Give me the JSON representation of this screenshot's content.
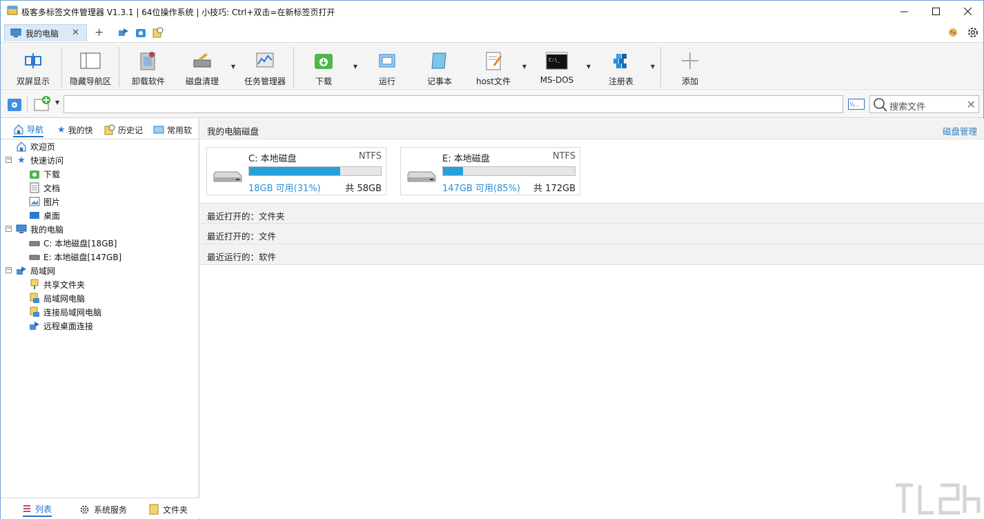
{
  "titlebar": {
    "title": "极客多标签文件管理器 V1.3.1  |  64位操作系统 | 小技巧: Ctrl+双击=在新标签页打开"
  },
  "tabs": {
    "active_label": "我的电脑",
    "new_tab": "+"
  },
  "toolbar": {
    "dual_screen": "双屏显示",
    "hide_nav": "隐藏导航区",
    "uninstall": "卸载软件",
    "disk_clean": "磁盘清理",
    "task_manager": "任务管理器",
    "download": "下载",
    "run": "运行",
    "notepad": "记事本",
    "hosts": "host文件",
    "msdos": "MS-DOS",
    "registry": "注册表",
    "add": "添加"
  },
  "search": {
    "placeholder": "搜索文件"
  },
  "left_tabs": {
    "nav": "导航",
    "favorites": "我的快",
    "history": "历史记",
    "common": "常用软"
  },
  "tree": {
    "welcome": "欢迎页",
    "quick_access": "快速访问",
    "downloads": "下载",
    "documents": "文档",
    "pictures": "图片",
    "desktop": "桌面",
    "my_computer": "我的电脑",
    "disk_c": "C: 本地磁盘[18GB]",
    "disk_e": "E: 本地磁盘[147GB]",
    "lan": "局域网",
    "shared": "共享文件夹",
    "lan_pc": "局域网电脑",
    "connect_lan": "连接局域网电脑",
    "remote_desktop": "远程桌面连接"
  },
  "left_bottom": {
    "list": "列表",
    "services": "系统服务",
    "folder": "文件夹"
  },
  "main": {
    "disks_title": "我的电脑磁盘",
    "disk_manage": "磁盘管理",
    "disks": [
      {
        "name": "C: 本地磁盘",
        "fs": "NTFS",
        "free": "18GB 可用(31%)",
        "total": "共 58GB",
        "used_fraction": 0.69
      },
      {
        "name": "E: 本地磁盘",
        "fs": "NTFS",
        "free": "147GB 可用(85%)",
        "total": "共 172GB",
        "used_fraction": 0.15
      }
    ],
    "recent_folders": "最近打开的：文件夹",
    "recent_files": "最近打开的：文件",
    "recent_software": "最近运行的：软件"
  },
  "colors": {
    "accent": "#1d73c4",
    "disk_bar": "#26a0da",
    "link": "#2b7fc0"
  }
}
